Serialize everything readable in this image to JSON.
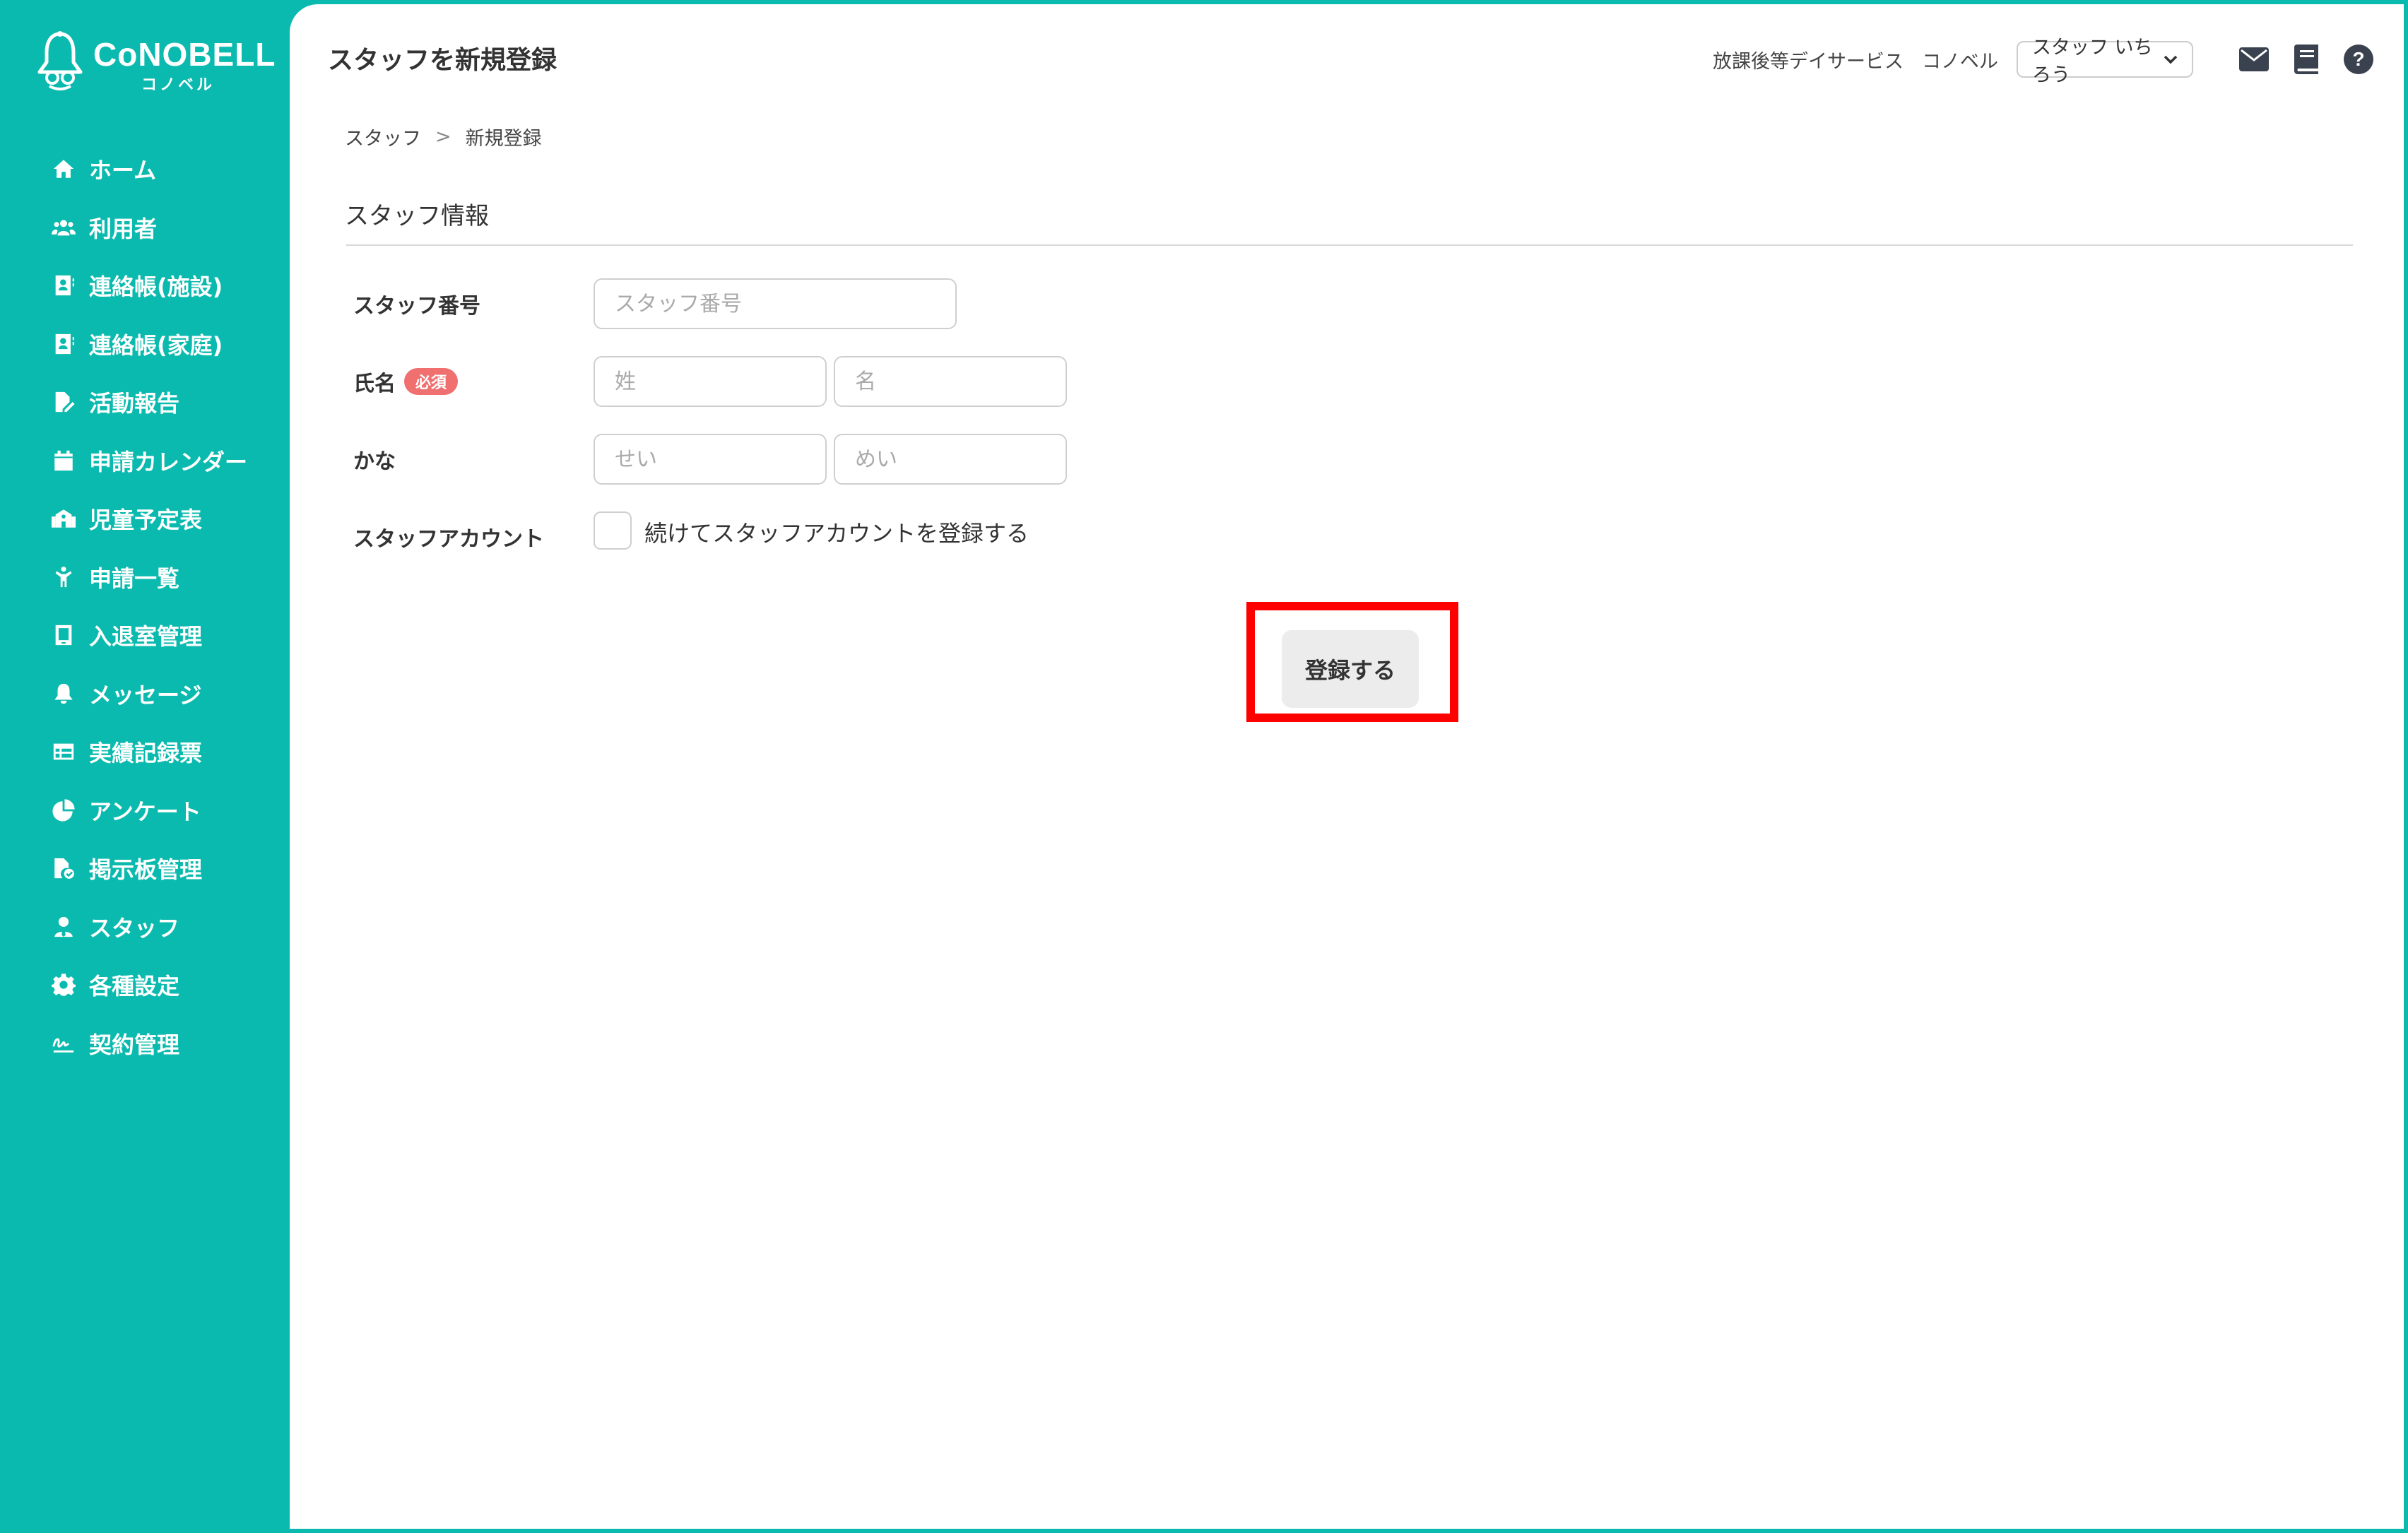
{
  "brand": {
    "name": "CoNOBELL",
    "sub": "コノベル"
  },
  "sidebar": {
    "items": [
      {
        "label": "ホーム",
        "icon": "home-icon"
      },
      {
        "label": "利用者",
        "icon": "users-icon"
      },
      {
        "label": "連絡帳(施設)",
        "icon": "address-book-icon"
      },
      {
        "label": "連絡帳(家庭)",
        "icon": "address-book-icon"
      },
      {
        "label": "活動報告",
        "icon": "file-pen-icon"
      },
      {
        "label": "申請カレンダー",
        "icon": "calendar-icon"
      },
      {
        "label": "児童予定表",
        "icon": "school-icon"
      },
      {
        "label": "申請一覧",
        "icon": "child-icon"
      },
      {
        "label": "入退室管理",
        "icon": "tablet-icon"
      },
      {
        "label": "メッセージ",
        "icon": "bell-icon"
      },
      {
        "label": "実績記録票",
        "icon": "table-icon"
      },
      {
        "label": "アンケート",
        "icon": "pie-chart-icon"
      },
      {
        "label": "掲示板管理",
        "icon": "file-check-icon"
      },
      {
        "label": "スタッフ",
        "icon": "user-tie-icon"
      },
      {
        "label": "各種設定",
        "icon": "gear-icon"
      },
      {
        "label": "契約管理",
        "icon": "signature-icon"
      }
    ]
  },
  "header": {
    "title": "スタッフを新規登録",
    "facility": "放課後等デイサービス",
    "org": "コノベル",
    "user": "スタッフ いちろう"
  },
  "breadcrumb": {
    "parent": "スタッフ",
    "current": "新規登録",
    "separator": ">"
  },
  "section": {
    "title": "スタッフ情報"
  },
  "form": {
    "staff_number": {
      "label": "スタッフ番号",
      "placeholder": "スタッフ番号"
    },
    "name": {
      "label": "氏名",
      "badge": "必須",
      "last_placeholder": "姓",
      "first_placeholder": "名"
    },
    "kana": {
      "label": "かな",
      "last_placeholder": "せい",
      "first_placeholder": "めい"
    },
    "account": {
      "label": "スタッフアカウント",
      "checkbox_label": "続けてスタッフアカウントを登録する"
    },
    "submit_label": "登録する"
  },
  "colors": {
    "sidebar": "#0abaae",
    "badge": "#f07070",
    "highlight": "#ff0000"
  }
}
